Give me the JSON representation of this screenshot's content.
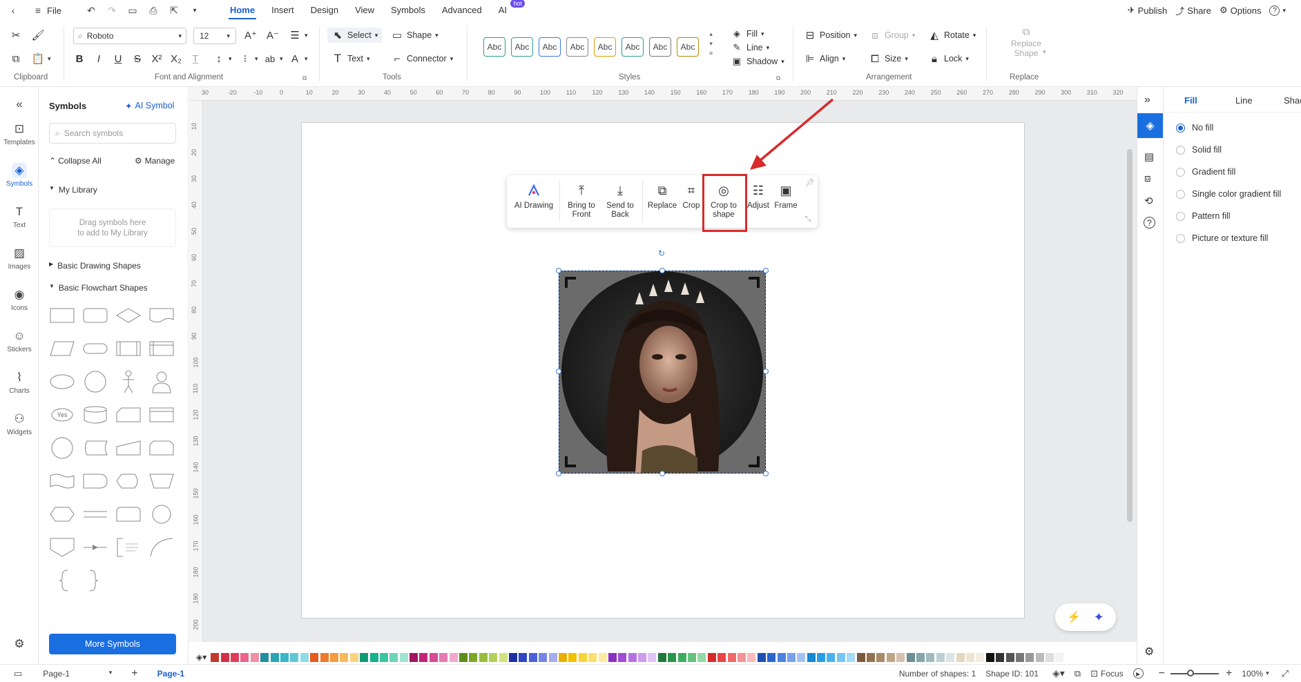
{
  "topbar": {
    "file_label": "File",
    "tabs": [
      {
        "label": "Home",
        "active": true
      },
      {
        "label": "Insert"
      },
      {
        "label": "Design"
      },
      {
        "label": "View"
      },
      {
        "label": "Symbols"
      },
      {
        "label": "Advanced"
      },
      {
        "label": "AI",
        "badge": "hot"
      }
    ],
    "publish": "Publish",
    "share": "Share",
    "options": "Options",
    "help": "?"
  },
  "ribbon": {
    "font_name": "Roboto",
    "font_size": "12",
    "select": "Select",
    "shape": "Shape",
    "text": "Text",
    "connector": "Connector",
    "style_sample": "Abc",
    "fill": "Fill",
    "line": "Line",
    "shadow": "Shadow",
    "position": "Position",
    "group": "Group",
    "rotate": "Rotate",
    "align": "Align",
    "size": "Size",
    "lock": "Lock",
    "replace_shape_1": "Replace",
    "replace_shape_2": "Shape",
    "groups": {
      "clipboard": "Clipboard",
      "font": "Font and Alignment",
      "tools": "Tools",
      "styles": "Styles",
      "arrangement": "Arrangement",
      "replace": "Replace"
    }
  },
  "rail": [
    {
      "label": "Templates"
    },
    {
      "label": "Symbols",
      "active": true
    },
    {
      "label": "Text"
    },
    {
      "label": "Images"
    },
    {
      "label": "Icons"
    },
    {
      "label": "Stickers"
    },
    {
      "label": "Charts"
    },
    {
      "label": "Widgets"
    }
  ],
  "symbols": {
    "title": "Symbols",
    "ai_symbol": "AI Symbol",
    "search_placeholder": "Search symbols",
    "collapse_all": "Collapse All",
    "manage": "Manage",
    "my_library": "My Library",
    "drop_hint_1": "Drag symbols here",
    "drop_hint_2": "to add to My Library",
    "basic_drawing": "Basic Drawing Shapes",
    "basic_flowchart": "Basic Flowchart Shapes",
    "yes_label": "Yes",
    "more_symbols": "More Symbols"
  },
  "ruler": {
    "top": [
      "30",
      "-20",
      "-10",
      "0",
      "10",
      "20",
      "30",
      "40",
      "50",
      "60",
      "70",
      "80",
      "90",
      "100",
      "110",
      "120",
      "130",
      "140",
      "150",
      "160",
      "170",
      "180",
      "190",
      "200",
      "210",
      "220",
      "230",
      "240",
      "250",
      "260",
      "270",
      "280",
      "290",
      "300",
      "310",
      "320"
    ],
    "left": [
      "10",
      "20",
      "30",
      "40",
      "50",
      "60",
      "70",
      "80",
      "90",
      "100",
      "110",
      "120",
      "130",
      "140",
      "150",
      "160",
      "170",
      "180",
      "190",
      "200"
    ]
  },
  "floatbar": {
    "ai_drawing": "AI Drawing",
    "bring_front_1": "Bring to",
    "bring_front_2": "Front",
    "send_back_1": "Send to",
    "send_back_2": "Back",
    "replace": "Replace",
    "crop": "Crop",
    "crop_shape_1": "Crop to",
    "crop_shape_2": "shape",
    "adjust": "Adjust",
    "frame": "Frame"
  },
  "rightpanel": {
    "tabs": [
      "Fill",
      "Line",
      "Shac"
    ],
    "options": [
      {
        "label": "No fill",
        "selected": true
      },
      {
        "label": "Solid fill"
      },
      {
        "label": "Gradient fill"
      },
      {
        "label": "Single color gradient fill"
      },
      {
        "label": "Pattern fill"
      },
      {
        "label": "Picture or texture fill"
      }
    ]
  },
  "palette": [
    "#c0392b",
    "#d32f45",
    "#e03b5b",
    "#e8668a",
    "#f08fa8",
    "#1f8f9f",
    "#2aa3b8",
    "#3cb6c9",
    "#5fc8d8",
    "#8ddde8",
    "#e65a1e",
    "#f07a2a",
    "#f59b3c",
    "#f9b95a",
    "#fcd27e",
    "#0d9c76",
    "#17b08b",
    "#3cc3a0",
    "#6dd4b8",
    "#a0e5d1",
    "#a3135f",
    "#c2247a",
    "#d84a95",
    "#e57bb1",
    "#f0a9cc",
    "#5e8c1e",
    "#7aa62a",
    "#97bd3c",
    "#b3d15a",
    "#cfe381",
    "#1f2fa3",
    "#2e44c2",
    "#4a5fd8",
    "#7585e5",
    "#a3adf0",
    "#e8b000",
    "#f2c200",
    "#f7d33c",
    "#fadf6e",
    "#fceaa0",
    "#8a2fc2",
    "#a34ad8",
    "#b871e5",
    "#cd9cef",
    "#e1c3f6",
    "#1e7a3c",
    "#2a944a",
    "#3cad5e",
    "#62c37e",
    "#93d8a7",
    "#d62b2b",
    "#e84545",
    "#ef6b6b",
    "#f49393",
    "#f8bcbc",
    "#1e4fb3",
    "#2a66d0",
    "#4a82e0",
    "#76a3ea",
    "#a6c4f2",
    "#1588d6",
    "#2a9ee8",
    "#4ab2ef",
    "#76c6f4",
    "#a6daf8",
    "#7a5a3c",
    "#92714f",
    "#a88a6a",
    "#bfa68a",
    "#d6c3ad",
    "#6b8f94",
    "#85a5a9",
    "#a0bbbe",
    "#bcd0d2",
    "#d8e4e5",
    "#e3d7c0",
    "#ece3d1",
    "#f3ede1",
    "#111111",
    "#333333",
    "#555555",
    "#777777",
    "#999999",
    "#bbbbbb",
    "#dddddd",
    "#f2f2f2"
  ],
  "status": {
    "page_select": "Page-1",
    "page_tab": "Page-1",
    "num_shapes": "Number of shapes: 1",
    "shape_id": "Shape ID: 101",
    "focus": "Focus",
    "zoom": "100%"
  }
}
